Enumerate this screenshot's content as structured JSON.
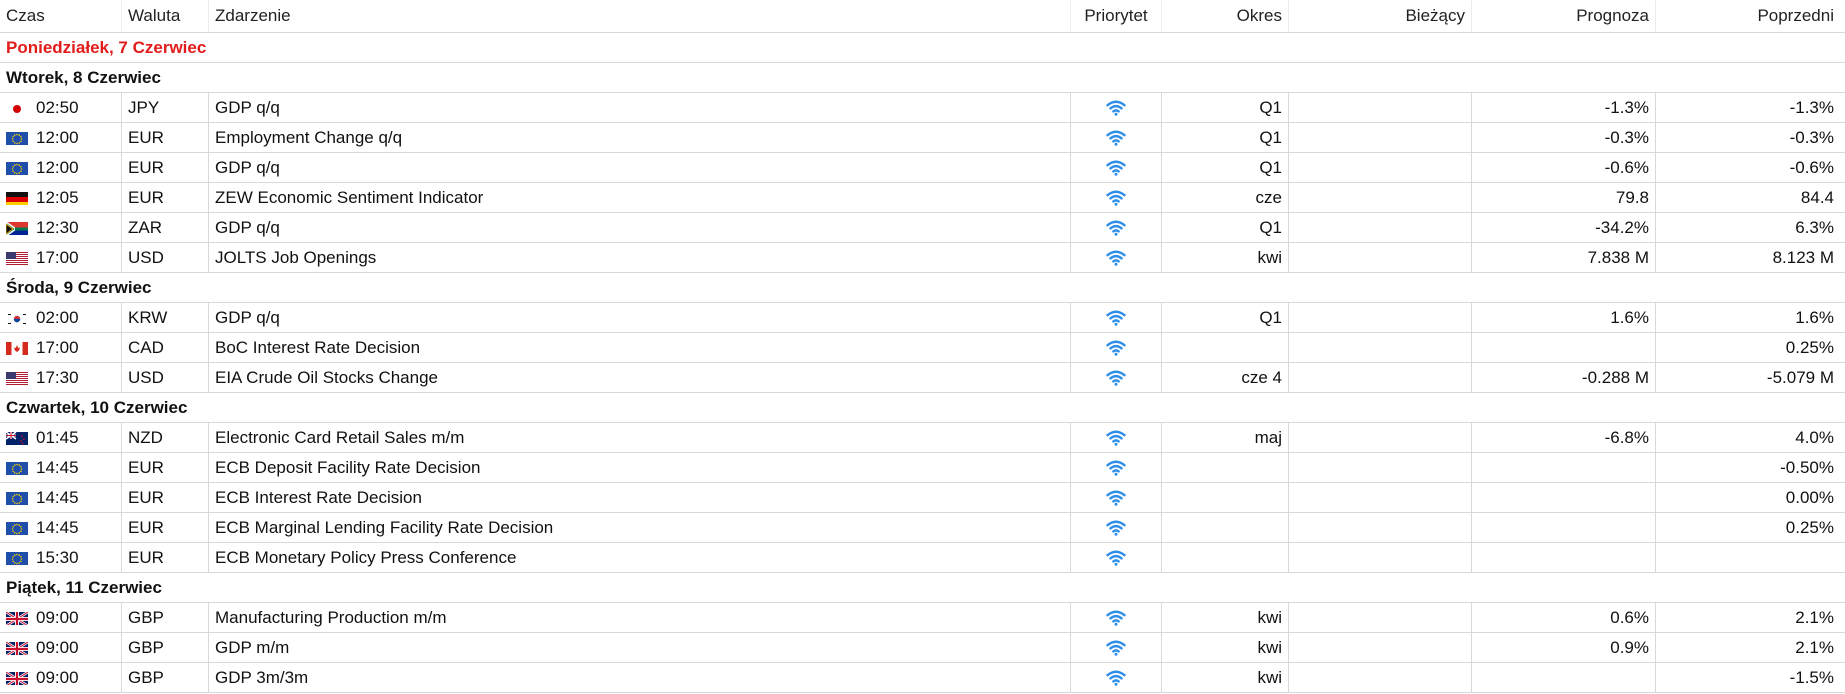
{
  "columns": {
    "czas": "Czas",
    "waluta": "Waluta",
    "zdarzenie": "Zdarzenie",
    "priorytet": "Priorytet",
    "okres": "Okres",
    "biezacy": "Bieżący",
    "prognoza": "Prognoza",
    "poprzedni": "Poprzedni"
  },
  "days": [
    {
      "label": "Poniedziałek, 7 Czerwiec",
      "today": true,
      "events": []
    },
    {
      "label": "Wtorek, 8 Czerwiec",
      "events": [
        {
          "flag": "jp",
          "time": "02:50",
          "currency": "JPY",
          "event": "GDP q/q",
          "period": "Q1",
          "actual": "",
          "forecast": "-1.3%",
          "previous": "-1.3%"
        },
        {
          "flag": "eu",
          "time": "12:00",
          "currency": "EUR",
          "event": "Employment Change q/q",
          "period": "Q1",
          "actual": "",
          "forecast": "-0.3%",
          "previous": "-0.3%"
        },
        {
          "flag": "eu",
          "time": "12:00",
          "currency": "EUR",
          "event": "GDP q/q",
          "period": "Q1",
          "actual": "",
          "forecast": "-0.6%",
          "previous": "-0.6%"
        },
        {
          "flag": "de",
          "time": "12:05",
          "currency": "EUR",
          "event": "ZEW Economic Sentiment Indicator",
          "period": "cze",
          "actual": "",
          "forecast": "79.8",
          "previous": "84.4"
        },
        {
          "flag": "za",
          "time": "12:30",
          "currency": "ZAR",
          "event": "GDP q/q",
          "period": "Q1",
          "actual": "",
          "forecast": "-34.2%",
          "previous": "6.3%"
        },
        {
          "flag": "us",
          "time": "17:00",
          "currency": "USD",
          "event": "JOLTS Job Openings",
          "period": "kwi",
          "actual": "",
          "forecast": "7.838 M",
          "previous": "8.123 M"
        }
      ]
    },
    {
      "label": "Środa, 9 Czerwiec",
      "events": [
        {
          "flag": "kr",
          "time": "02:00",
          "currency": "KRW",
          "event": "GDP q/q",
          "period": "Q1",
          "actual": "",
          "forecast": "1.6%",
          "previous": "1.6%"
        },
        {
          "flag": "ca",
          "time": "17:00",
          "currency": "CAD",
          "event": "BoC Interest Rate Decision",
          "period": "",
          "actual": "",
          "forecast": "",
          "previous": "0.25%"
        },
        {
          "flag": "us",
          "time": "17:30",
          "currency": "USD",
          "event": "EIA Crude Oil Stocks Change",
          "period": "cze 4",
          "actual": "",
          "forecast": "-0.288 M",
          "previous": "-5.079 M"
        }
      ]
    },
    {
      "label": "Czwartek, 10 Czerwiec",
      "events": [
        {
          "flag": "nz",
          "time": "01:45",
          "currency": "NZD",
          "event": "Electronic Card Retail Sales m/m",
          "period": "maj",
          "actual": "",
          "forecast": "-6.8%",
          "previous": "4.0%"
        },
        {
          "flag": "eu",
          "time": "14:45",
          "currency": "EUR",
          "event": "ECB Deposit Facility Rate Decision",
          "period": "",
          "actual": "",
          "forecast": "",
          "previous": "-0.50%"
        },
        {
          "flag": "eu",
          "time": "14:45",
          "currency": "EUR",
          "event": "ECB Interest Rate Decision",
          "period": "",
          "actual": "",
          "forecast": "",
          "previous": "0.00%"
        },
        {
          "flag": "eu",
          "time": "14:45",
          "currency": "EUR",
          "event": "ECB Marginal Lending Facility Rate Decision",
          "period": "",
          "actual": "",
          "forecast": "",
          "previous": "0.25%"
        },
        {
          "flag": "eu",
          "time": "15:30",
          "currency": "EUR",
          "event": "ECB Monetary Policy Press Conference",
          "period": "",
          "actual": "",
          "forecast": "",
          "previous": ""
        }
      ]
    },
    {
      "label": "Piątek, 11 Czerwiec",
      "events": [
        {
          "flag": "gb",
          "time": "09:00",
          "currency": "GBP",
          "event": "Manufacturing Production m/m",
          "period": "kwi",
          "actual": "",
          "forecast": "0.6%",
          "previous": "2.1%"
        },
        {
          "flag": "gb",
          "time": "09:00",
          "currency": "GBP",
          "event": "GDP m/m",
          "period": "kwi",
          "actual": "",
          "forecast": "0.9%",
          "previous": "2.1%"
        },
        {
          "flag": "gb",
          "time": "09:00",
          "currency": "GBP",
          "event": "GDP 3m/3m",
          "period": "kwi",
          "actual": "",
          "forecast": "",
          "previous": "-1.5%"
        }
      ]
    }
  ],
  "colors": {
    "today": "#e21b1b",
    "priority_icon": "#2d8ee8",
    "grid_line": "#d9d9d9"
  },
  "icons": {
    "priority": "wifi-signal-icon"
  }
}
